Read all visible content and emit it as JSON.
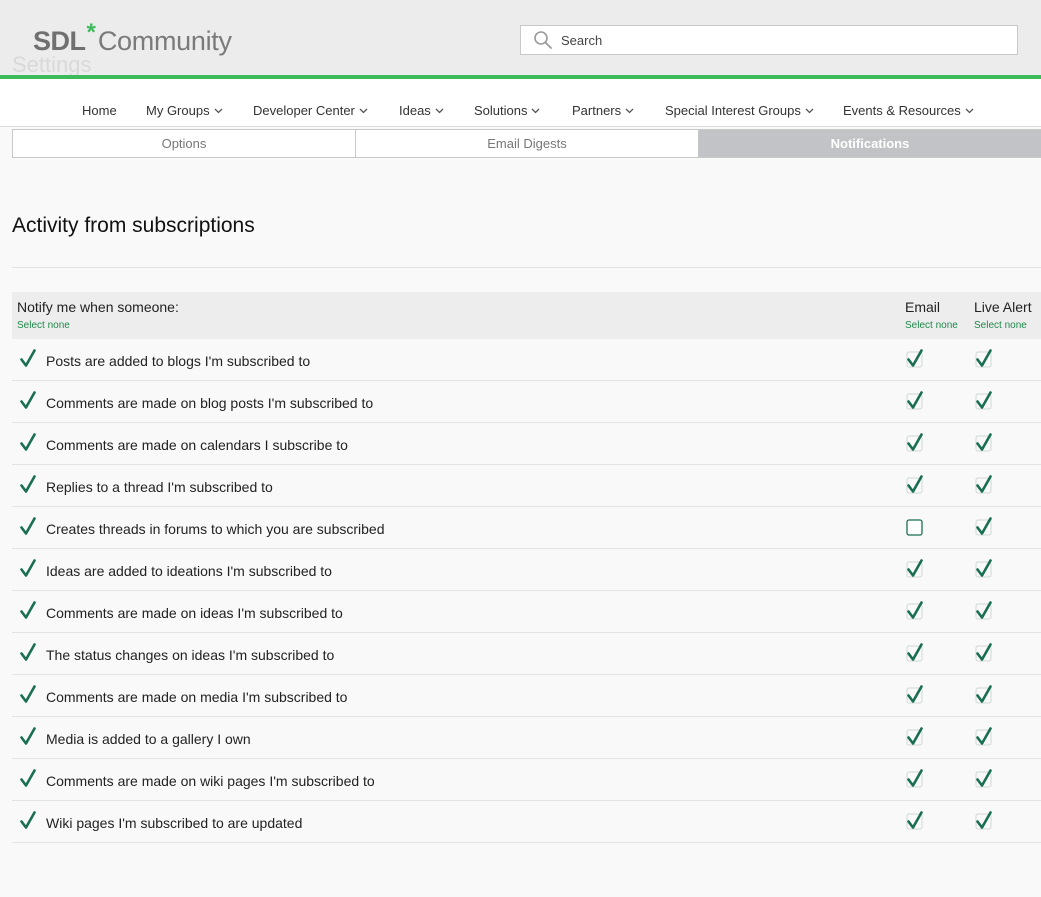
{
  "header": {
    "logo": {
      "sdl": "SDL",
      "star": "*",
      "community": "Community"
    },
    "ghost_title": "Settings",
    "search": {
      "placeholder": "Search",
      "value": ""
    },
    "icons": {
      "search": "search-icon",
      "dropdown": "chevron-down-icon",
      "check": "check-icon"
    }
  },
  "nav": {
    "items": [
      {
        "label": "Home",
        "has_menu": false
      },
      {
        "label": "My Groups",
        "has_menu": true
      },
      {
        "label": "Developer Center",
        "has_menu": true
      },
      {
        "label": "Ideas",
        "has_menu": true
      },
      {
        "label": "Solutions",
        "has_menu": true
      },
      {
        "label": "Partners",
        "has_menu": true
      },
      {
        "label": "Special Interest Groups",
        "has_menu": true
      },
      {
        "label": "Events & Resources",
        "has_menu": true
      }
    ]
  },
  "tabs": [
    {
      "label": "Options",
      "active": false
    },
    {
      "label": "Email Digests",
      "active": false
    },
    {
      "label": "Notifications",
      "active": true
    }
  ],
  "section": {
    "title": "Activity from subscriptions"
  },
  "table": {
    "header": {
      "notify_label": "Notify me when someone:",
      "notify_select_none": "Select none",
      "email_label": "Email",
      "email_select_none": "Select none",
      "live_label": "Live Alert",
      "live_select_none": "Select none"
    },
    "rows": [
      {
        "label": "Posts are added to blogs I'm subscribed to",
        "enabled": true,
        "email": true,
        "live": true
      },
      {
        "label": "Comments are made on blog posts I'm subscribed to",
        "enabled": true,
        "email": true,
        "live": true
      },
      {
        "label": "Comments are made on calendars I subscribe to",
        "enabled": true,
        "email": true,
        "live": true
      },
      {
        "label": "Replies to a thread I'm subscribed to",
        "enabled": true,
        "email": true,
        "live": true
      },
      {
        "label": "Creates threads in forums to which you are subscribed",
        "enabled": true,
        "email": false,
        "live": true
      },
      {
        "label": "Ideas are added to ideations I'm subscribed to",
        "enabled": true,
        "email": true,
        "live": true
      },
      {
        "label": "Comments are made on ideas I'm subscribed to",
        "enabled": true,
        "email": true,
        "live": true
      },
      {
        "label": "The status changes on ideas I'm subscribed to",
        "enabled": true,
        "email": true,
        "live": true
      },
      {
        "label": "Comments are made on media I'm subscribed to",
        "enabled": true,
        "email": true,
        "live": true
      },
      {
        "label": "Media is added to a gallery I own",
        "enabled": true,
        "email": true,
        "live": true
      },
      {
        "label": "Comments are made on wiki pages I'm subscribed to",
        "enabled": true,
        "email": true,
        "live": true
      },
      {
        "label": "Wiki pages I'm subscribed to are updated",
        "enabled": true,
        "email": true,
        "live": true
      }
    ]
  },
  "colors": {
    "accent_green": "#3dbb5c",
    "check_green": "#1a6e52",
    "link_green": "#1e8a4c",
    "active_tab": "#c1c3c6"
  }
}
